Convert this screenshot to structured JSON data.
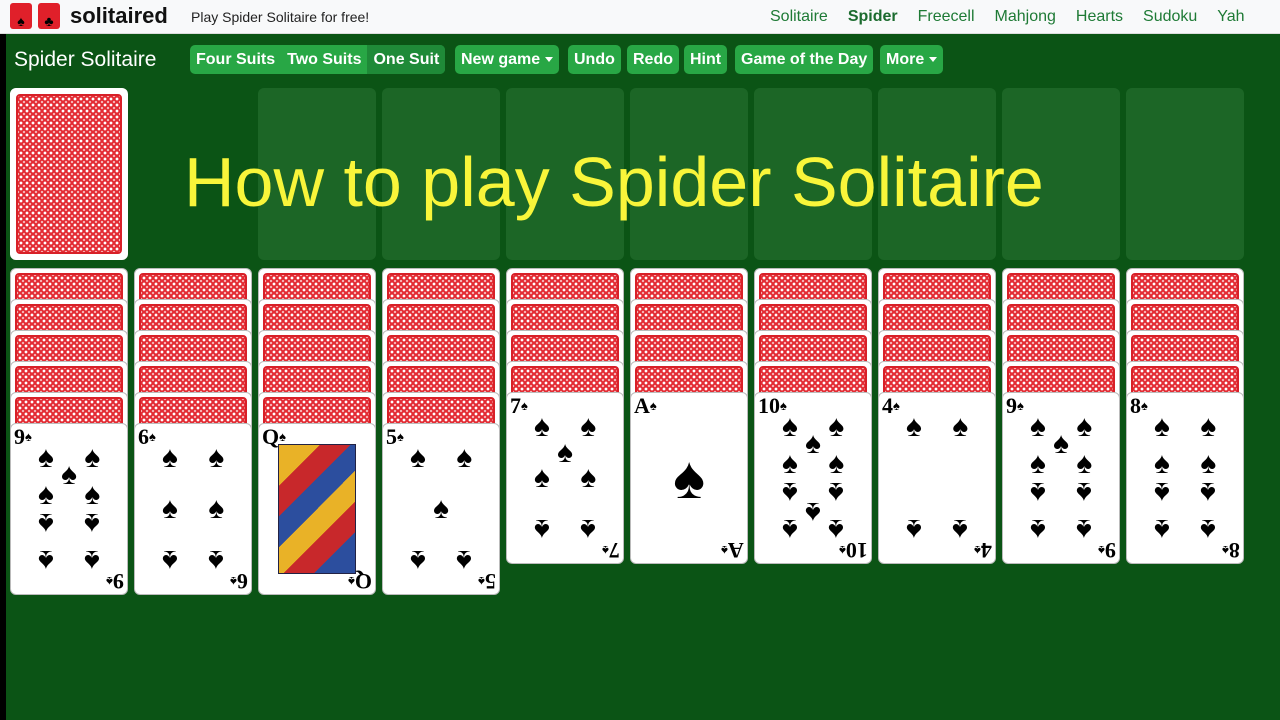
{
  "site": {
    "logo_text": "solitaired",
    "tagline": "Play Spider Solitaire for free!",
    "nav": [
      {
        "label": "Solitaire"
      },
      {
        "label": "Spider",
        "active": true
      },
      {
        "label": "Freecell"
      },
      {
        "label": "Mahjong"
      },
      {
        "label": "Hearts"
      },
      {
        "label": "Sudoku"
      },
      {
        "label": "Yah"
      }
    ]
  },
  "toolbar": {
    "title": "Spider Solitaire",
    "suits": [
      "Four Suits",
      "Two Suits",
      "One Suit"
    ],
    "selected_suit": "One Suit",
    "new_game": "New game",
    "undo": "Undo",
    "redo": "Redo",
    "hint": "Hint",
    "gotd": "Game of the Day",
    "more": "More"
  },
  "overlay": "How to play Spider Solitaire",
  "colors": {
    "felt": "#0b5415",
    "button": "#28a745",
    "overlay_text": "#f8f53a",
    "card_back": "#e32b33"
  },
  "tableau": [
    {
      "face_down": 5,
      "top": "9",
      "suit": "♠"
    },
    {
      "face_down": 5,
      "top": "6",
      "suit": "♠"
    },
    {
      "face_down": 5,
      "top": "Q",
      "suit": "♠"
    },
    {
      "face_down": 5,
      "top": "5",
      "suit": "♠"
    },
    {
      "face_down": 4,
      "top": "7",
      "suit": "♠"
    },
    {
      "face_down": 4,
      "top": "A",
      "suit": "♠"
    },
    {
      "face_down": 4,
      "top": "10",
      "suit": "♠"
    },
    {
      "face_down": 4,
      "top": "4",
      "suit": "♠"
    },
    {
      "face_down": 4,
      "top": "9",
      "suit": "♠"
    },
    {
      "face_down": 4,
      "top": "8",
      "suit": "♠"
    }
  ],
  "foundation_slots": 8,
  "stock": {
    "visible": true
  }
}
